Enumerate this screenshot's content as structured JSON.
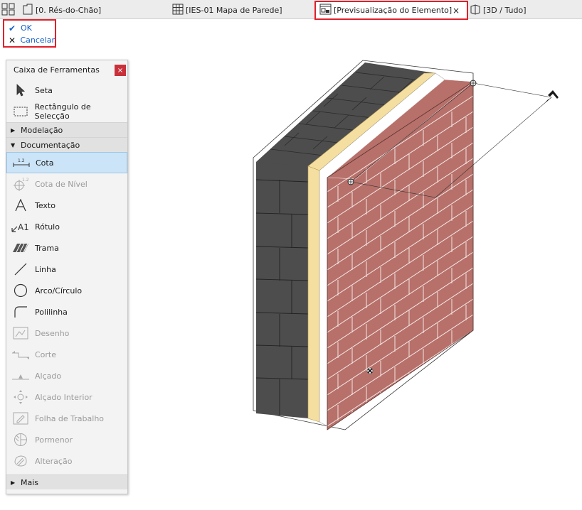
{
  "tabs": {
    "floor": "[0. Rés-do-Chão]",
    "ies": "[IES-01 Mapa de Parede]",
    "preview": "[Previsualização do Elemento]",
    "preview_close": "×",
    "threed": "[3D / Tudo]"
  },
  "dialog": {
    "ok": "OK",
    "cancel": "Cancelar"
  },
  "toolbox": {
    "title": "Caixa de Ferramentas",
    "close": "×",
    "select_tools": [
      "Seta",
      "Rectângulo de Selecção"
    ],
    "sections": {
      "modelacao": "Modelação",
      "documentacao": "Documentação",
      "mais": "Mais"
    },
    "doc_tools": [
      "Cota",
      "Cota de Nível",
      "Texto",
      "Rótulo",
      "Trama",
      "Linha",
      "Arco/Círculo",
      "Polilinha",
      "Desenho",
      "Corte",
      "Alçado",
      "Alçado Interior",
      "Folha de Trabalho",
      "Pormenor",
      "Alteração"
    ]
  },
  "colors": {
    "highlight": "#e0202a",
    "link": "#1560c8",
    "brick": "#b7706a",
    "block": "#4d4d4d",
    "insulation": "#f5dfa0"
  }
}
